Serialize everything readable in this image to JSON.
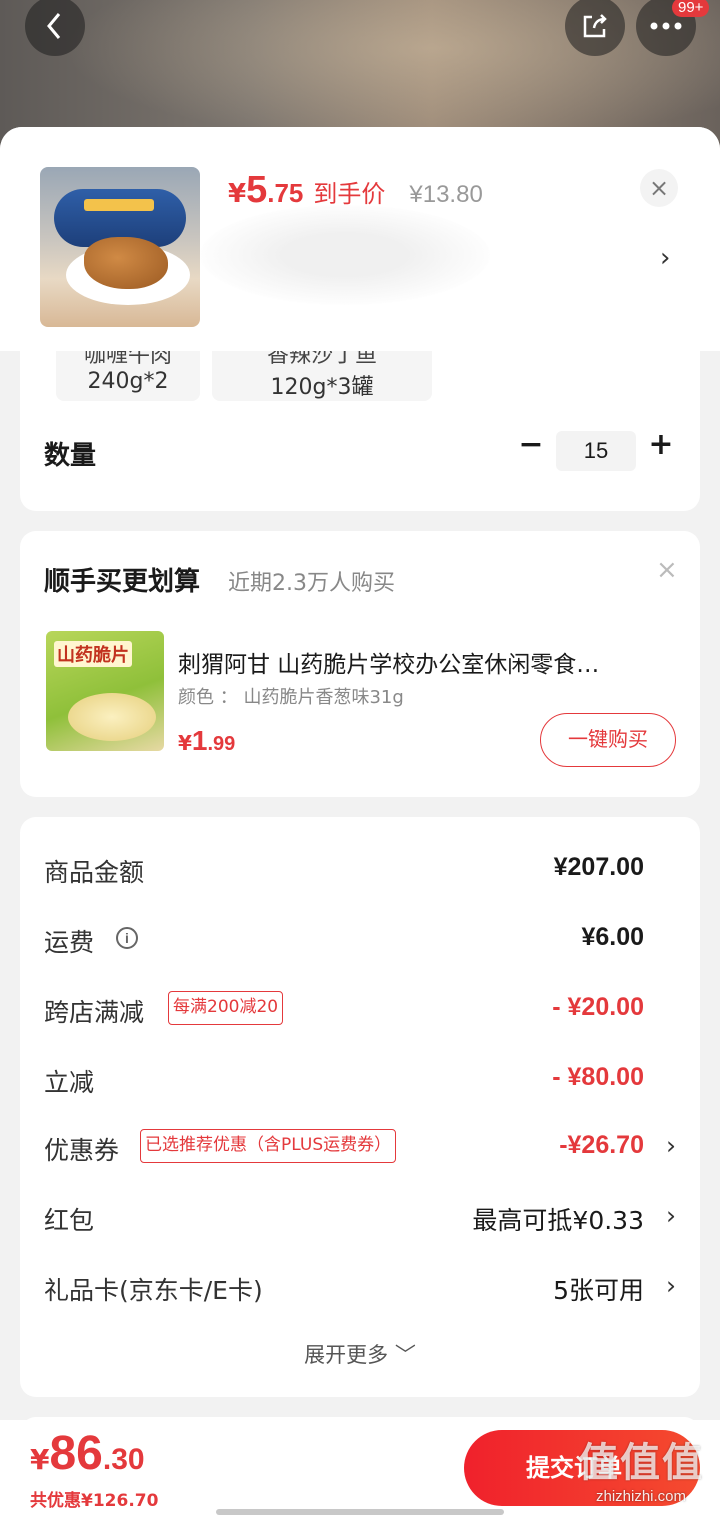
{
  "header": {
    "badge": "99+"
  },
  "product": {
    "price_symbol": "¥",
    "price_int": "5",
    "price_dec": ".75",
    "price_tag": "到手价",
    "original_price": "¥13.80"
  },
  "spec": {
    "chip1_line1": "咖喱牛肉",
    "chip1_line2": "240g*2",
    "chip2_line1": "香辣沙丁鱼",
    "chip2_line2": "120g*3罐",
    "quantity_label": "数量",
    "quantity_value": "15"
  },
  "addon": {
    "title": "顺手买更划算",
    "subtitle": "近期2.3万人购买",
    "item_name": "刺猬阿甘 山药脆片学校办公室休闲零食…",
    "item_spec": "颜色 ： 山药脆片香葱味31g",
    "item_image_label": "山药脆片",
    "price_symbol": "¥",
    "price_int": "1",
    "price_dec": ".99",
    "buy_label": "一键购买"
  },
  "summary": {
    "rows": [
      {
        "label": "商品金额",
        "value": "¥207.00"
      },
      {
        "label": "运费",
        "value": "¥6.00"
      },
      {
        "label": "跨店满减",
        "tag": "每满200减20",
        "value": "- ¥20.00"
      },
      {
        "label": "立减",
        "value": "- ¥80.00"
      },
      {
        "label": "优惠券",
        "tag": "已选推荐优惠（含PLUS运费券）",
        "value": "-¥26.70"
      },
      {
        "label": "红包",
        "value": "最高可抵¥0.33"
      },
      {
        "label": "礼品卡(京东卡/E卡)",
        "value": "5张可用"
      }
    ],
    "expand_label": "展开更多"
  },
  "footer": {
    "price_symbol": "¥",
    "total_int": "86",
    "total_dec": ".30",
    "save_note": "共优惠¥126.70",
    "submit_label": "提交订单"
  },
  "watermark": {
    "text": "值值值",
    "url": "zhizhizhi.com"
  },
  "colors": {
    "accent": "#e4393c",
    "background": "#f2f2f2"
  }
}
